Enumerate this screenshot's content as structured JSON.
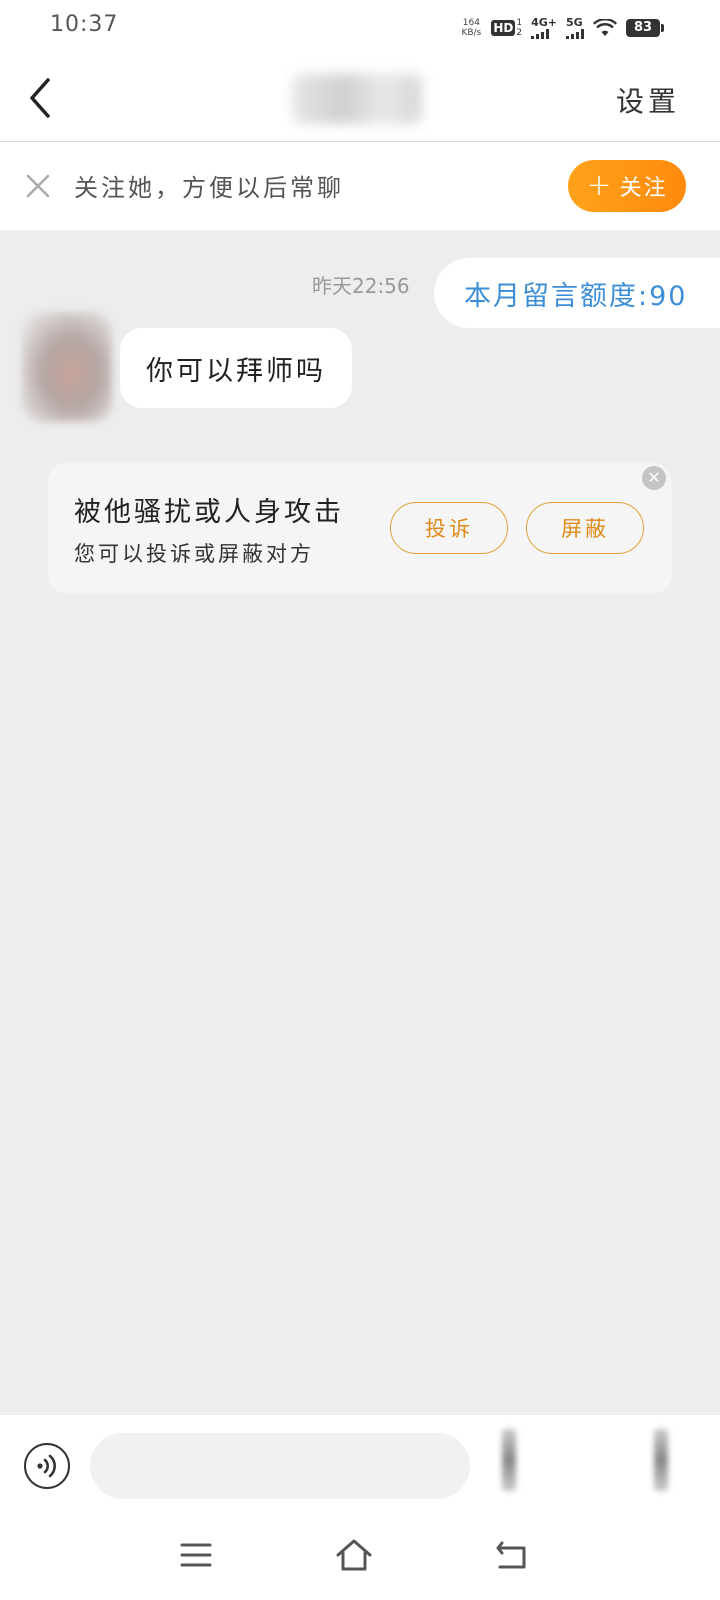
{
  "status_bar": {
    "time": "10:37",
    "net_speed_value": "164",
    "net_speed_unit": "KB/s",
    "hd_label": "HD",
    "hd_sub_top": "1",
    "hd_sub_bottom": "2",
    "network_1": "4G+",
    "network_2": "5G",
    "battery": "83"
  },
  "header": {
    "settings_label": "设置"
  },
  "follow_bar": {
    "text": "关注她，方便以后常聊",
    "follow_label": "关注"
  },
  "chat": {
    "timestamp": "昨天22:56",
    "quota_text": "本月留言额度:90",
    "incoming_message": "你可以拜师吗"
  },
  "report_card": {
    "title": "被他骚扰或人身攻击",
    "subtitle": "您可以投诉或屏蔽对方",
    "report_label": "投诉",
    "block_label": "屏蔽"
  },
  "input_bar": {
    "placeholder": ""
  },
  "colors": {
    "accent_orange": "#ff8a0c",
    "quota_blue": "#3d8ed8",
    "chat_background": "#ededed"
  }
}
